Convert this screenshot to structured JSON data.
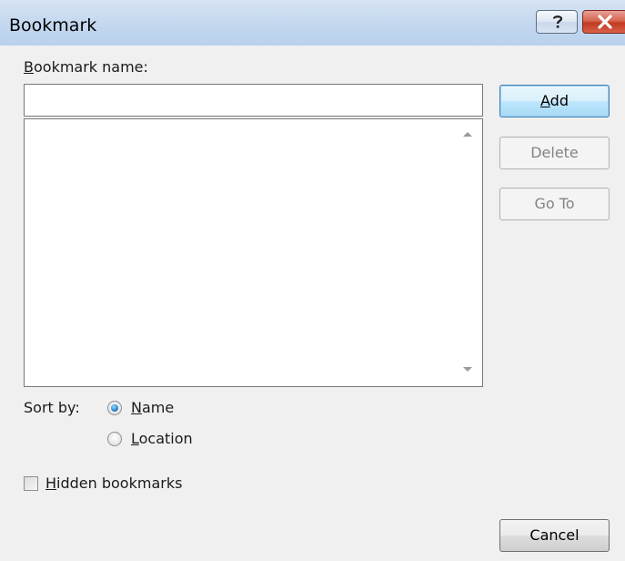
{
  "window": {
    "title": "Bookmark",
    "help_icon": "question-mark-icon",
    "close_icon": "close-x-icon",
    "close_color": "#c23a22"
  },
  "bookmark_name": {
    "label_mnemonic": "B",
    "label_rest": "ookmark name:",
    "value": ""
  },
  "bookmark_list": {
    "items": []
  },
  "buttons": {
    "add_mnemonic": "A",
    "add_rest": "dd",
    "delete": "Delete",
    "goto": "Go To",
    "cancel": "Cancel"
  },
  "sort": {
    "label": "Sort by:",
    "selected": "Name",
    "options": [
      {
        "mnemonic": "N",
        "rest": "ame",
        "checked": true
      },
      {
        "mnemonic": "L",
        "rest": "ocation",
        "checked": false
      }
    ]
  },
  "hidden": {
    "mnemonic": "H",
    "rest": "idden bookmarks",
    "checked": false
  }
}
